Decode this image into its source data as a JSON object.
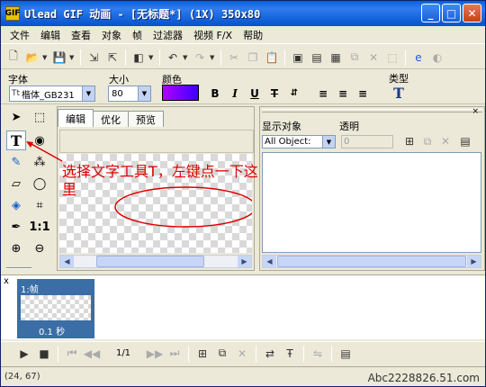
{
  "window": {
    "title": "Ulead GIF 动画 - [无标题*] (1X) 350x80",
    "app_icon_label": "GIF",
    "min_label": "_",
    "max_label": "□",
    "close_label": "✕"
  },
  "menu": [
    "文件",
    "编辑",
    "查看",
    "对象",
    "帧",
    "过滤器",
    "视频 F/X",
    "帮助"
  ],
  "properties": {
    "font_label": "字体",
    "font_value": "楷体_GB231",
    "size_label": "大小",
    "size_value": "80",
    "color_label": "颜色",
    "color_value": "#8a00ff",
    "type_label": "类型",
    "bold": "B",
    "italic": "I",
    "underline": "U",
    "strike": "T"
  },
  "editor": {
    "tabs": [
      "编辑",
      "优化",
      "预览"
    ],
    "annotation": "选择文字工具T，左键点一下这里"
  },
  "objects": {
    "show_label": "显示对象",
    "transparency_label": "透明",
    "filter_value": "All Object:",
    "transparency_value": "0"
  },
  "frames": {
    "panel_close": "x",
    "frame_label": "1:帧",
    "frame_delay": "0.1 秒",
    "counter": "1/1"
  },
  "status": {
    "coords": "(24, 67)",
    "watermark": "Abc2228826.51.com"
  },
  "colors": {
    "titlebar": "#0a5fd8",
    "annotation": "#e00000",
    "frame_selected": "#3a6ea5"
  }
}
